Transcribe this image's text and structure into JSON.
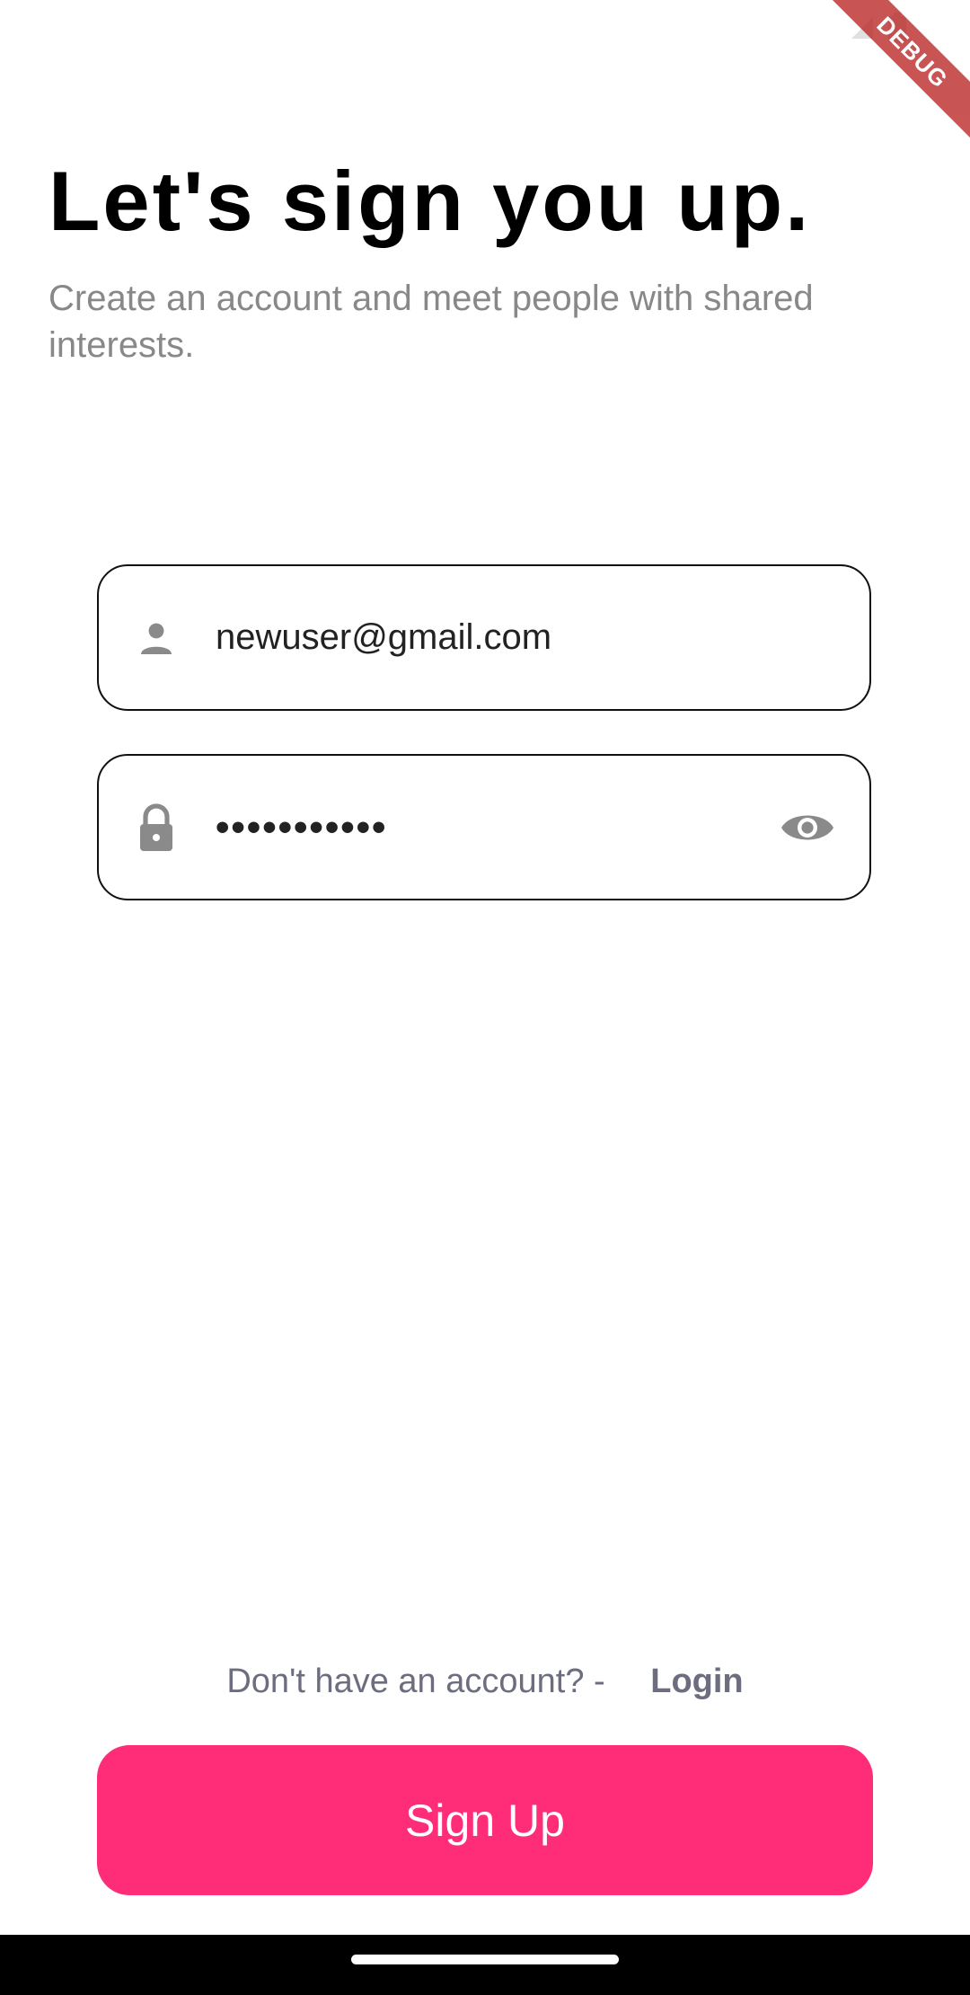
{
  "debug_banner": {
    "label": "DEBUG"
  },
  "header": {
    "title": "Let's sign you up.",
    "subtitle": "Create an account and meet people with shared interests."
  },
  "form": {
    "email": {
      "value": "newuser@gmail.com",
      "icon": "person-icon"
    },
    "password": {
      "masked_value": "•••••••••••",
      "icon": "lock-icon",
      "toggle_icon": "eye-icon"
    }
  },
  "footer": {
    "prompt": "Don't have an account? -",
    "login_label": "Login",
    "signup_label": "Sign Up"
  },
  "colors": {
    "accent": "#ff2d78",
    "muted_text": "#888888",
    "link_text": "#6d6d80"
  }
}
